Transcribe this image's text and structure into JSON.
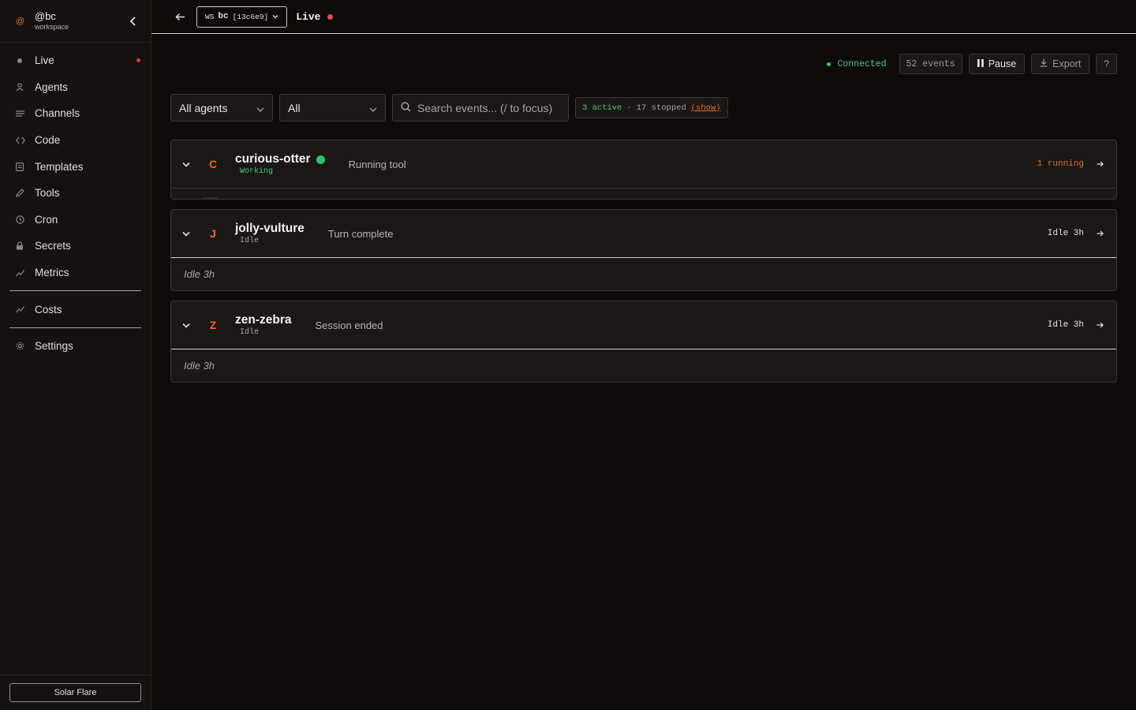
{
  "sidebar": {
    "workspace_handle": "@bc",
    "workspace_sub": "workspace",
    "items": [
      {
        "label": "Live",
        "icon": "live-icon"
      },
      {
        "label": "Agents",
        "icon": "agents-icon"
      },
      {
        "label": "Channels",
        "icon": "channels-icon"
      },
      {
        "label": "Code",
        "icon": "code-icon"
      },
      {
        "label": "Templates",
        "icon": "templates-icon"
      },
      {
        "label": "Tools",
        "icon": "tools-icon"
      },
      {
        "label": "Cron",
        "icon": "cron-icon"
      },
      {
        "label": "Secrets",
        "icon": "secrets-icon"
      },
      {
        "label": "Metrics",
        "icon": "metrics-icon"
      },
      {
        "label": "Costs",
        "icon": "costs-icon"
      },
      {
        "label": "Settings",
        "icon": "settings-icon"
      }
    ],
    "theme_button": "Solar Flare"
  },
  "topbar": {
    "ws_prefix": "WS",
    "ws_name": "bc",
    "ws_id": "[13c6e9]",
    "title": "Live"
  },
  "status": {
    "connection": "Connected",
    "events": "52 events",
    "pause_label": "Pause",
    "export_label": "Export",
    "help_label": "?"
  },
  "filters": {
    "agent_filter": "All agents",
    "type_filter": "All",
    "search_placeholder": "Search events... (/ to focus)",
    "active": "3 active",
    "sep": "·",
    "stopped": "17 stopped",
    "show_link": "(show)"
  },
  "agents": [
    {
      "initial": "C",
      "name": "curious-otter",
      "state": "Working",
      "message": "Running tool",
      "right": "1 running",
      "body": ""
    },
    {
      "initial": "J",
      "name": "jolly-vulture",
      "state": "Idle",
      "message": "Turn complete",
      "right": "Idle 3h",
      "body": "Idle 3h"
    },
    {
      "initial": "Z",
      "name": "zen-zebra",
      "state": "Idle",
      "message": "Session ended",
      "right": "Idle 3h",
      "body": "Idle 3h"
    }
  ],
  "colors": {
    "accent": "#e0702e",
    "success": "#3fbf6a",
    "live_dot": "#e84a55",
    "background": "#0d0b0a"
  }
}
